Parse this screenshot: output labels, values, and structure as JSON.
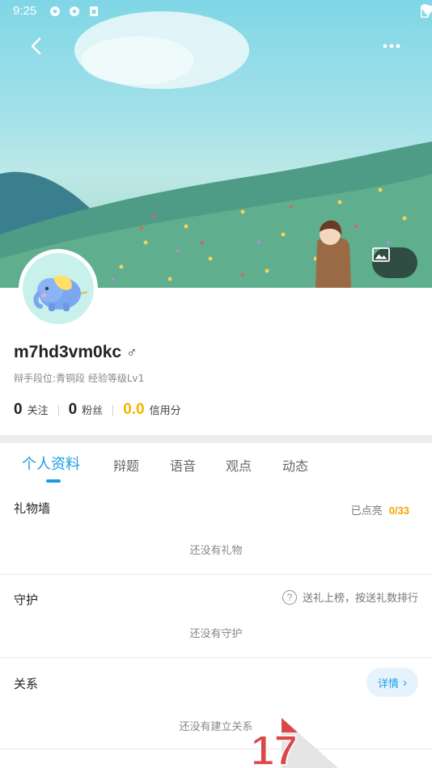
{
  "status_bar": {
    "time": "9:25",
    "left_icons": [
      "settings-icon",
      "settings-icon",
      "sim-card-icon"
    ],
    "right_icons": [
      "wifi-icon",
      "battery-icon"
    ]
  },
  "header": {
    "back_icon": "chevron-left-icon",
    "more_icon": "more-dots-icon",
    "change_background_icon": "image-icon"
  },
  "profile": {
    "username": "m7hd3vm0kc",
    "gender_symbol": "♂",
    "rank_line": "辩手段位:青铜段 经验等级Lv1",
    "stats": {
      "following_count": "0",
      "following_label": "关注",
      "followers_count": "0",
      "followers_label": "粉丝",
      "credit_score": "0.0",
      "credit_label": "信用分"
    }
  },
  "tabs": [
    {
      "label": "个人资料",
      "active": true
    },
    {
      "label": "辩题",
      "active": false
    },
    {
      "label": "语音",
      "active": false
    },
    {
      "label": "观点",
      "active": false
    },
    {
      "label": "动态",
      "active": false
    }
  ],
  "sections": {
    "gift_wall": {
      "title": "礼物墙",
      "lit_label": "已点亮",
      "lit_count": "0/33",
      "empty_text": "还没有礼物"
    },
    "guard": {
      "title": "守护",
      "hint": "送礼上榜，按送礼数排行",
      "help_symbol": "?",
      "empty_text": "还没有守护"
    },
    "relations": {
      "title": "关系",
      "detail_label": "详情",
      "detail_chevron": "›",
      "empty_text": "还没有建立关系"
    }
  },
  "watermark_text": "17",
  "colors": {
    "accent": "#1a9de6",
    "credit": "#f4b400",
    "lit_count": "#f4a400",
    "divider_band": "#eeeeee"
  }
}
